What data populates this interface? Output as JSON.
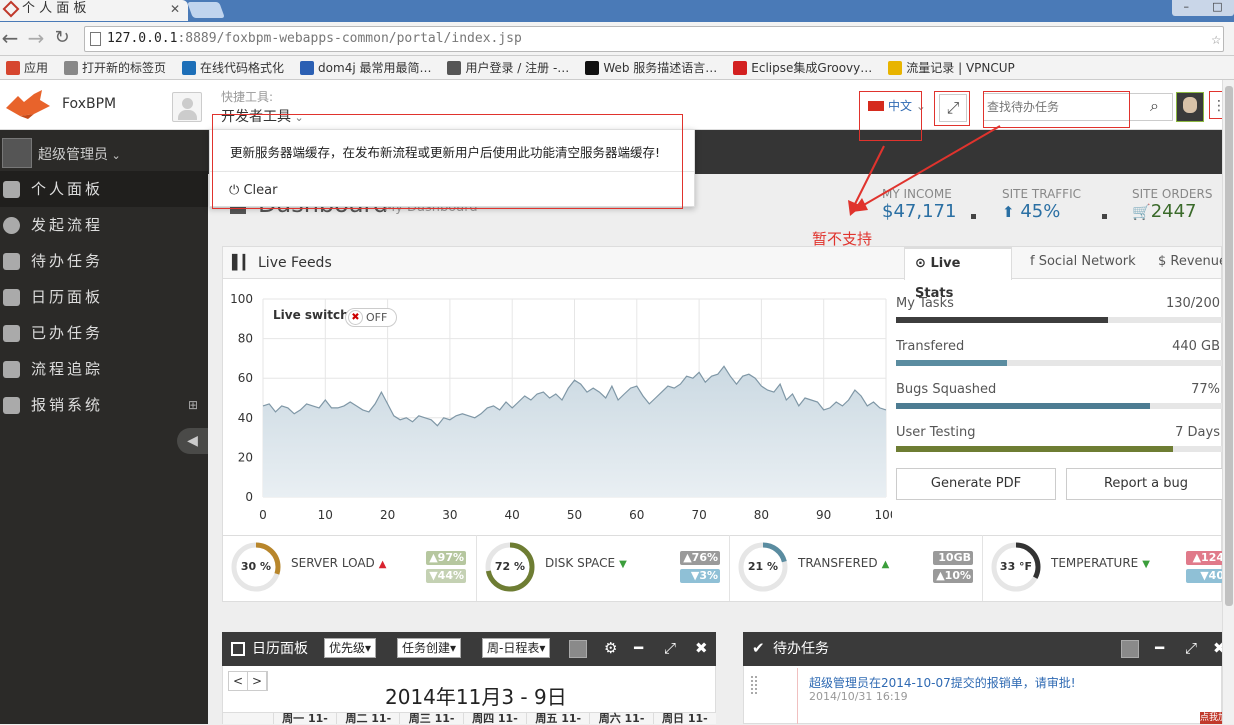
{
  "browser": {
    "tab_title": "个 人 面 板",
    "url_host": "127.0.0.1",
    "url_rest": ":8889/foxbpm-webapps-common/portal/index.jsp",
    "bookmarks": [
      "应用",
      "打开新的标签页",
      "在线代码格式化",
      "dom4j 最常用最简…",
      "用户登录 / 注册 -…",
      "Web 服务描述语言…",
      "Eclipse集成Groovy…",
      "流量记录 | VPNCUP"
    ],
    "bookmark_colors": [
      "#d6462f",
      "#888888",
      "#1d6fb8",
      "#2b5fb3",
      "#555555",
      "#111111",
      "#d32020",
      "#e8b400"
    ]
  },
  "header": {
    "logo_text": "FoxBPM",
    "quick_tools_label": "快捷工具:",
    "quick_tools_value": "开发者工具",
    "language": "中文",
    "search_placeholder": "查找待办任务"
  },
  "dropdown": {
    "text": "更新服务器端缓存，在发布新流程或更新用户后使用此功能清空服务器端缓存!",
    "clear_label": "Clear"
  },
  "annotation": "暂不支持",
  "sidebar": {
    "user": "超级管理员",
    "items": [
      {
        "label": "个人面板",
        "icon": "dashboard-icon",
        "active": true
      },
      {
        "label": "发起流程",
        "icon": "arrow-circle-icon"
      },
      {
        "label": "待办任务",
        "icon": "list-icon"
      },
      {
        "label": "日历面板",
        "icon": "calendar-icon"
      },
      {
        "label": "已办任务",
        "icon": "check-icon"
      },
      {
        "label": "流程追踪",
        "icon": "check-square-icon"
      },
      {
        "label": "报销系统",
        "icon": "calendar-icon"
      }
    ]
  },
  "page": {
    "title": "Dashboard",
    "subtitle": "My Dashboard",
    "stats": [
      {
        "label": "MY INCOME",
        "value": "$47,171"
      },
      {
        "label": "SITE TRAFFIC",
        "value": "45%"
      },
      {
        "label": "SITE ORDERS",
        "value": "2447"
      }
    ]
  },
  "feeds": {
    "title": "Live Feeds",
    "tabs": [
      "Live Stats",
      "Social Network",
      "Revenue"
    ],
    "live_switch": "Live switch",
    "switch_state": "OFF",
    "progress": [
      {
        "label": "My Tasks",
        "value": "130/200",
        "fraction": 0.65,
        "color": "#3d3d3d"
      },
      {
        "label": "Transfered",
        "value": "440 GB",
        "fraction": 0.34,
        "color": "#5a8ca0"
      },
      {
        "label": "Bugs Squashed",
        "value": "77%",
        "fraction": 0.78,
        "color": "#4d7c92"
      },
      {
        "label": "User Testing",
        "value": "7 Days",
        "fraction": 0.85,
        "color": "#6e7d33"
      }
    ],
    "buttons": [
      "Generate PDF",
      "Report a bug"
    ]
  },
  "chart_data": {
    "type": "area",
    "x": [
      0,
      1,
      2,
      3,
      4,
      5,
      6,
      7,
      8,
      9,
      10,
      11,
      12,
      13,
      14,
      15,
      16,
      17,
      18,
      19,
      20,
      21,
      22,
      23,
      24,
      25,
      26,
      27,
      28,
      29,
      30,
      31,
      32,
      33,
      34,
      35,
      36,
      37,
      38,
      39,
      40,
      41,
      42,
      43,
      44,
      45,
      46,
      47,
      48,
      49,
      50,
      51,
      52,
      53,
      54,
      55,
      56,
      57,
      58,
      59,
      60,
      61,
      62,
      63,
      64,
      65,
      66,
      67,
      68,
      69,
      70,
      71,
      72,
      73,
      74,
      75,
      76,
      77,
      78,
      79,
      80,
      81,
      82,
      83,
      84,
      85,
      86,
      87,
      88,
      89,
      90,
      91,
      92,
      93,
      94,
      95,
      96,
      97,
      98,
      99,
      100
    ],
    "y": [
      46,
      47,
      43,
      46,
      45,
      42,
      44,
      47,
      46,
      45,
      49,
      45,
      45,
      46,
      48,
      46,
      44,
      43,
      47,
      53,
      47,
      41,
      39,
      40,
      38,
      41,
      40,
      39,
      36,
      40,
      39,
      41,
      42,
      41,
      40,
      42,
      45,
      46,
      44,
      48,
      45,
      48,
      51,
      49,
      52,
      53,
      50,
      52,
      49,
      55,
      59,
      57,
      53,
      55,
      53,
      50,
      56,
      49,
      52,
      55,
      56,
      51,
      47,
      50,
      53,
      56,
      55,
      57,
      61,
      60,
      63,
      58,
      61,
      62,
      66,
      61,
      57,
      61,
      62,
      60,
      56,
      54,
      53,
      57,
      49,
      52,
      46,
      50,
      49,
      48,
      44,
      45,
      48,
      46,
      49,
      54,
      51,
      46,
      48,
      45,
      44
    ],
    "xlim": [
      0,
      100
    ],
    "ylim": [
      0,
      100
    ],
    "xticks": [
      0,
      10,
      20,
      30,
      40,
      50,
      60,
      70,
      80,
      90,
      100
    ],
    "yticks": [
      0,
      20,
      40,
      60,
      80,
      100
    ],
    "grid": true,
    "color": "#a9c0cd"
  },
  "gauges": [
    {
      "value": "30 %",
      "fraction": 0.3,
      "color": "#b8862b",
      "label": "SERVER LOAD",
      "trend": "up",
      "trend_color": "#d9232f",
      "pills": [
        {
          "text": "97%",
          "dir": "up",
          "color": "#b6c79f"
        },
        {
          "text": "44%",
          "dir": "down",
          "color": "#c4d1b3"
        }
      ]
    },
    {
      "value": "72 %",
      "fraction": 0.72,
      "color": "#6e7d33",
      "label": "DISK SPACE",
      "trend": "down",
      "trend_color": "#3b9e3b",
      "pills": [
        {
          "text": "76%",
          "dir": "up",
          "color": "#9a9a9a"
        },
        {
          "text": "3%",
          "dir": "down",
          "color": "#8fc0d6"
        }
      ]
    },
    {
      "value": "21 %",
      "fraction": 0.21,
      "color": "#5a8ca0",
      "label": "TRANSFERED",
      "trend": "up",
      "trend_color": "#3b9e3b",
      "pills": [
        {
          "text": "10GB",
          "dir": "",
          "color": "#9a9a9a"
        },
        {
          "text": "10%",
          "dir": "up",
          "color": "#9a9a9a"
        }
      ]
    },
    {
      "value": "33 °F",
      "fraction": 0.33,
      "color": "#333333",
      "label": "TEMPERATURE",
      "trend": "down",
      "trend_color": "#3b9e3b",
      "pills": [
        {
          "text": "124",
          "dir": "up",
          "color": "#e07a8a"
        },
        {
          "text": "40",
          "dir": "down",
          "color": "#8fc0d6"
        }
      ]
    }
  ],
  "calendar": {
    "title": "日历面板",
    "selects": [
      "优先级",
      "任务创建",
      "周-日程表"
    ],
    "nav": [
      "<",
      ">"
    ],
    "range": "2014年11月3 - 9日",
    "days": [
      "周一 11-",
      "周二 11-",
      "周三 11-",
      "周四 11-",
      "周五 11-",
      "周六 11-",
      "周日 11-"
    ]
  },
  "todo": {
    "title": "待办任务",
    "item_text": "超级管理员在2014-10-07提交的报销单，请审批!",
    "item_time": "2014/10/31 16:19"
  },
  "corner_badge": "点我加"
}
